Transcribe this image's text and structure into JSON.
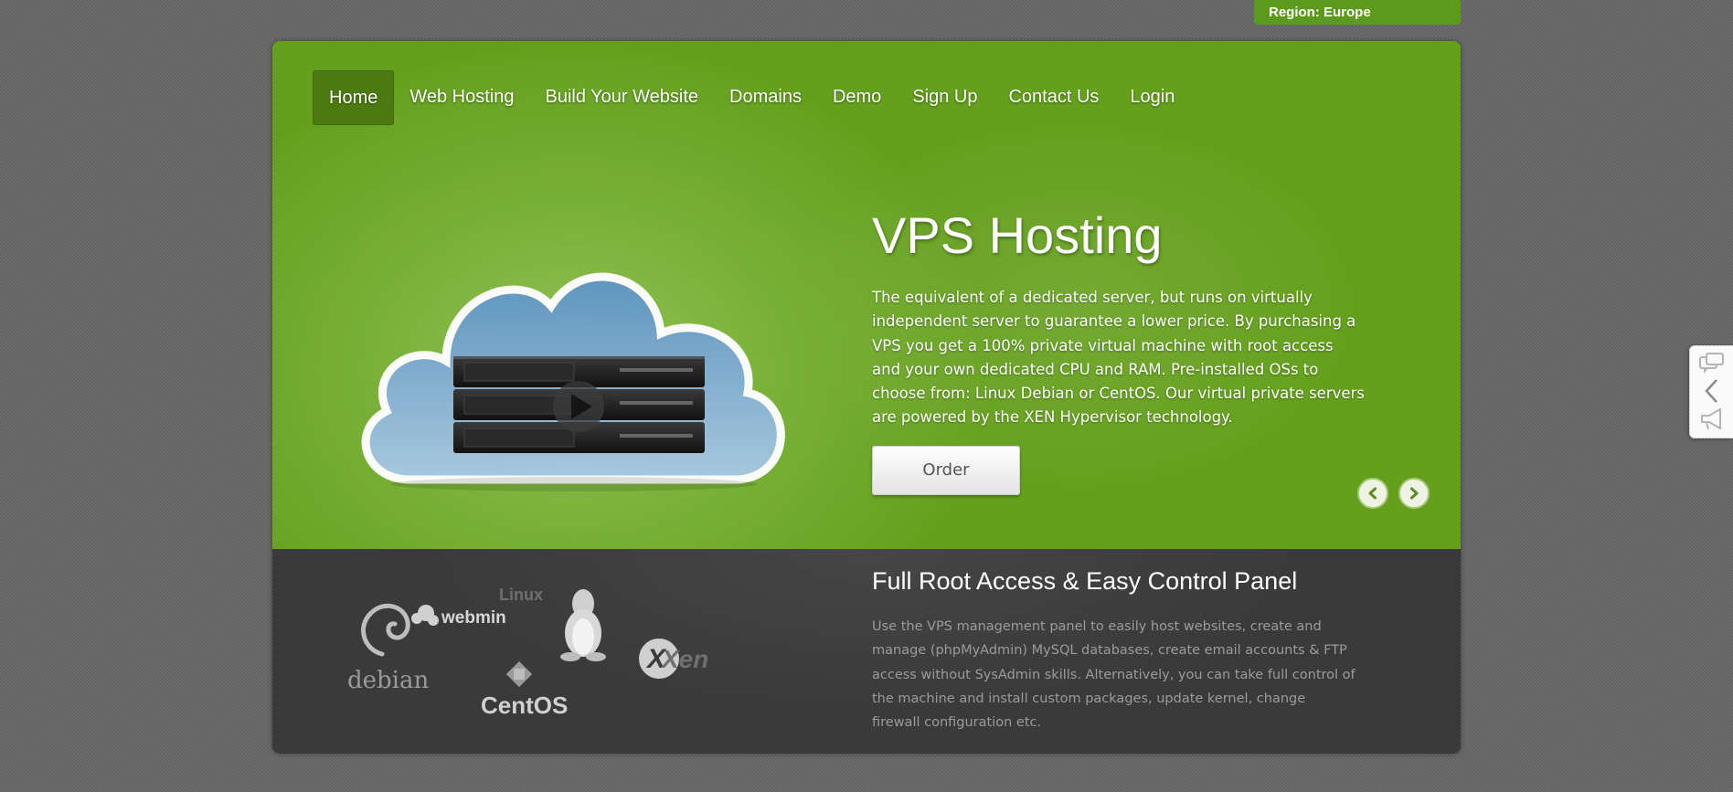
{
  "region": {
    "label": "Region: Europe"
  },
  "nav": {
    "items": [
      {
        "label": "Home",
        "active": true
      },
      {
        "label": "Web Hosting"
      },
      {
        "label": "Build Your Website"
      },
      {
        "label": "Domains"
      },
      {
        "label": "Demo"
      },
      {
        "label": "Sign Up"
      },
      {
        "label": "Contact Us"
      },
      {
        "label": "Login"
      }
    ]
  },
  "hero": {
    "title": "VPS Hosting",
    "description": "The equivalent of a dedicated server, but runs on virtually independent server to guarantee a lower price. By purchasing a VPS you get a 100% private virtual machine with root access and your own dedicated CPU and RAM. Pre-installed OSs to choose from: Linux Debian or CentOS. Our virtual private servers are powered by the XEN Hypervisor technology.",
    "order_label": "Order",
    "image_icon": "cloud-server-icon",
    "prev_icon": "chevron-left-icon",
    "next_icon": "chevron-right-icon"
  },
  "features": {
    "title": "Full Root Access & Easy Control Panel",
    "description": "Use the VPS management panel to easily host websites, create and manage (phpMyAdmin) MySQL databases, create email accounts & FTP access without SysAdmin skills. Alternatively, you can take full control of the machine and install custom packages, update kernel, change firewall configuration etc.",
    "logos": {
      "debian": "debian",
      "webmin": "webmin",
      "linux": "Linux",
      "centos": "CentOS",
      "xen": "Xen"
    }
  },
  "colors": {
    "accent": "#64a01c",
    "nav_active": "#4d7a10",
    "dark_panel": "#3a3a3a"
  },
  "side_widget": {
    "icons": [
      "chat-icon",
      "chevron-left-icon",
      "megaphone-icon"
    ]
  }
}
